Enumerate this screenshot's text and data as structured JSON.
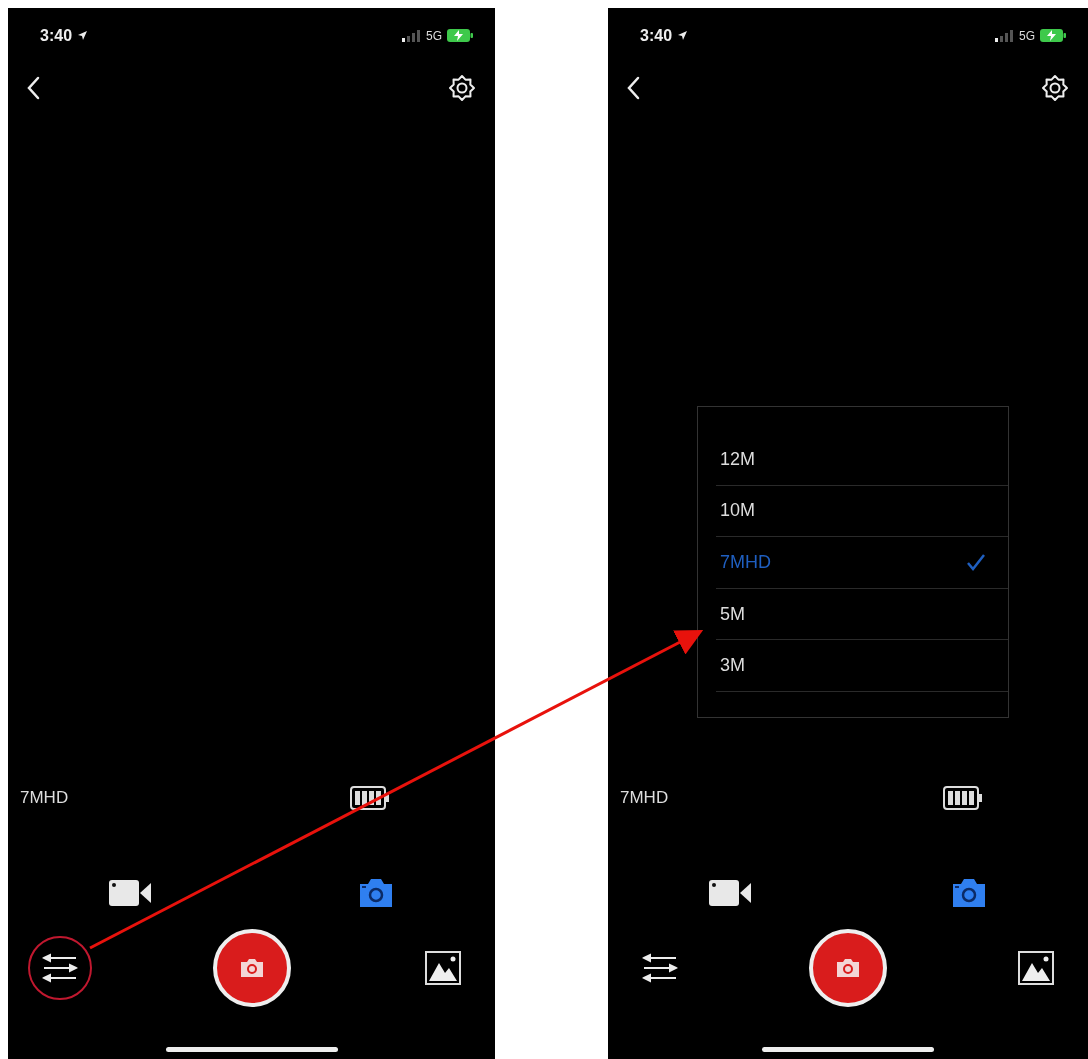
{
  "screens": [
    {
      "status_bar": {
        "time": "3:40",
        "network": "5G"
      },
      "resolution": "7MHD",
      "modes": [
        {
          "kind": "video",
          "selected": false
        },
        {
          "kind": "photo",
          "selected": true
        }
      ],
      "settings_highlighted": true
    },
    {
      "status_bar": {
        "time": "3:40",
        "network": "5G"
      },
      "resolution": "7MHD",
      "modes": [
        {
          "kind": "video",
          "selected": false
        },
        {
          "kind": "photo",
          "selected": true
        }
      ],
      "settings_highlighted": false,
      "resolution_menu": {
        "options": [
          {
            "label": "12M",
            "selected": false
          },
          {
            "label": "10M",
            "selected": false
          },
          {
            "label": "7MHD",
            "selected": true
          },
          {
            "label": "5M",
            "selected": false
          },
          {
            "label": "3M",
            "selected": false
          }
        ]
      }
    }
  ]
}
